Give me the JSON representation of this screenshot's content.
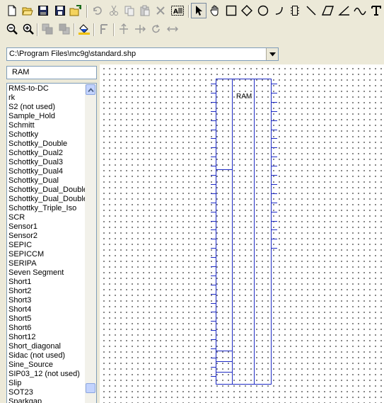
{
  "toolbar1": {
    "buttons": [
      "new-icon",
      "open-icon",
      "save-icon",
      "save-all-icon",
      "import-icon",
      "undo-icon",
      "cut-icon",
      "copy-icon",
      "paste-icon",
      "delete-icon",
      "select-all-icon",
      "pointer-icon",
      "pan-icon",
      "rectangle-icon",
      "diamond-icon",
      "ellipse-icon",
      "arc-icon",
      "block-icon",
      "line-icon",
      "polygon-icon",
      "polyline-icon",
      "sine-icon",
      "text-icon"
    ]
  },
  "toolbar2": {
    "buttons": [
      "zoom-out-icon",
      "zoom-in-icon",
      "bring-front-icon",
      "send-back-icon",
      "fill-icon",
      "font-icon",
      "flip-vertical-icon",
      "flip-horizontal-icon",
      "rotate-icon",
      "mirror-icon"
    ]
  },
  "shape_file": {
    "path": "C:\\Program Files\\mc9g\\standard.shp"
  },
  "search": {
    "value": "RAM"
  },
  "shape_list": {
    "items": [
      "RMS-to-DC",
      "rk",
      "S2 (not used)",
      "Sample_Hold",
      "Schmitt",
      "Schottky",
      "Schottky_Double",
      "Schottky_Dual2",
      "Schottky_Dual3",
      "Schottky_Dual4",
      "Schottky_Dual",
      "Schottky_Dual_Double",
      "Schottky_Dual_Double",
      "Schottky_Triple_Iso",
      "SCR",
      "Sensor1",
      "Sensor2",
      "SEPIC",
      "SEPICCM",
      "SERIPA",
      "Seven Segment",
      "Short1",
      "Short2",
      "Short3",
      "Short4",
      "Short5",
      "Short6",
      "Short12",
      "Short_diagonal",
      "Sidac (not used)",
      "Sine_Source",
      "SIP03_12 (not used)",
      "Slip",
      "SOT23",
      "Sparkgap"
    ]
  },
  "canvas": {
    "shape_label": "RAM"
  }
}
